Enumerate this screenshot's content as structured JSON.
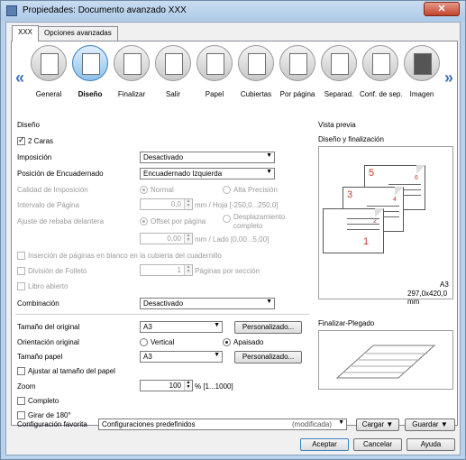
{
  "window": {
    "title": "Propiedades: Documento avanzado XXX",
    "close": "✕"
  },
  "tabs": [
    {
      "label": "XXX"
    },
    {
      "label": "Opciones avanzadas"
    }
  ],
  "iconbar": {
    "prev": "«",
    "next": "»",
    "items": [
      {
        "label": "General"
      },
      {
        "label": "Diseño"
      },
      {
        "label": "Finalizar"
      },
      {
        "label": "Salir"
      },
      {
        "label": "Papel"
      },
      {
        "label": "Cubiertas"
      },
      {
        "label": "Por página"
      },
      {
        "label": "Separad."
      },
      {
        "label": "Conf. de sep."
      },
      {
        "label": "Imagen"
      }
    ]
  },
  "layout": {
    "section_title": "Diseño",
    "two_sided": "2 Caras",
    "imposition_label": "Imposición",
    "imposition_value": "Desactivado",
    "binding_label": "Posición de Encuadernado",
    "binding_value": "Encuadernado Izquierda",
    "quality_label": "Calidad de Imposición",
    "quality_normal": "Normal",
    "quality_high": "Alta Precisión",
    "interval_label": "Intervalo de Página",
    "interval_value": "0,0",
    "interval_unit": "mm / Hoja [-250,0...250,0]",
    "trim_label": "Ajuste de rebaba delantera",
    "trim_offset": "Offset por página",
    "trim_shift": "Desplazamiento completo",
    "trim_value": "0,00",
    "trim_unit": "mm / Lado [0,00...5,00]",
    "insert_blank": "Inserción de páginas en blanco en la cubierta del cuadernillo",
    "booklet_div": "División de Folleto",
    "booklet_value": "1",
    "booklet_unit": "Páginas por sección",
    "open_book": "Libro abierto",
    "combination_label": "Combinación",
    "combination_value": "Desactivado"
  },
  "paper": {
    "orig_size_label": "Tamaño del original",
    "orig_size_value": "A3",
    "custom1": "Personalizado...",
    "orientation_label": "Orientación original",
    "portrait": "Vertical",
    "landscape": "Apaisado",
    "paper_size_label": "Tamaño papel",
    "paper_size_value": "A3",
    "custom2": "Personalizado...",
    "fit": "Ajustar al tamaño del papel",
    "zoom_label": "Zoom",
    "zoom_value": "100",
    "zoom_unit": "% [1...1000]",
    "complete": "Completo",
    "rotate": "Girar de 180°"
  },
  "preview": {
    "section_title": "Vista previa",
    "layout_title": "Diseño y finalización",
    "page_numbers": [
      "5",
      "6",
      "3",
      "4",
      "1",
      "2"
    ],
    "size_label": "A3",
    "size_dims": "297,0x420,0 mm",
    "folding_title": "Finalizar-Plegado"
  },
  "footer": {
    "fav_label": "Configuración favorita",
    "fav_value": "Configuraciones predefinidos",
    "fav_modified": "(modificada)",
    "load": "Cargar",
    "save": "Guardar",
    "ok": "Aceptar",
    "cancel": "Cancelar",
    "help": "Ayuda"
  }
}
